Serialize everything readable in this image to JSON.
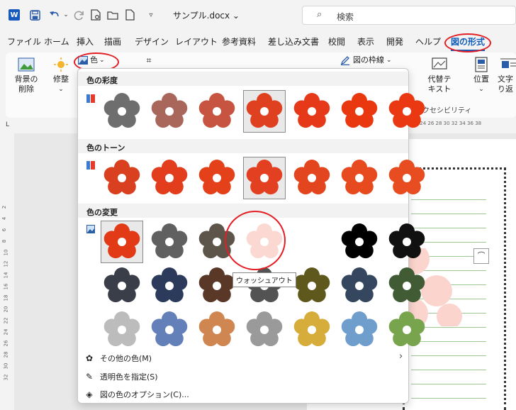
{
  "titlebar": {
    "logo": "W",
    "quick_icons": [
      "save-icon",
      "undo-icon",
      "redo-icon",
      "print-preview-icon",
      "open-icon",
      "new-icon",
      "customize-icon"
    ],
    "doc_name": "サンプル.docx ⌄",
    "search_placeholder": "検索",
    "search_icon": "⌕"
  },
  "menubar": {
    "tabs": [
      "ファイル",
      "ホーム",
      "挿入",
      "描画",
      "デザイン",
      "レイアウト",
      "参考資料",
      "差し込み文書",
      "校閲",
      "表示",
      "開発",
      "ヘルプ",
      "図の形式"
    ],
    "active": "図の形式"
  },
  "ribbon": {
    "remove_bg": "背景の\n削除",
    "corrections": "修整",
    "color_btn": "色",
    "border_btn": "図の枠線",
    "alt_text": "代替テ\nキスト",
    "position": "位置",
    "wrap_text": "文字\nり返",
    "accessibility": "アクセシビリティ"
  },
  "ruler": {
    "horizontal": "20 22 24 26 28 30 32 34 36 38",
    "vertical": [
      "2",
      "4",
      "6",
      "8",
      "10",
      "12",
      "14",
      "16",
      "18",
      "20",
      "22",
      "24",
      "26",
      "28",
      "30",
      "32"
    ],
    "marker": "L"
  },
  "dropdown": {
    "saturation": {
      "title": "色の彩度",
      "colors": [
        "#6e6e6e",
        "#a9665a",
        "#c65440",
        "#de4020",
        "#e5391a",
        "#e9370f",
        "#ea3812"
      ],
      "selected": 3
    },
    "tone": {
      "title": "色のトーン",
      "colors": [
        "#d94020",
        "#e23d1d",
        "#e4411b",
        "#e24020",
        "#e3451e",
        "#e64a1e",
        "#e84d22"
      ],
      "selected": 3
    },
    "recolor": {
      "title": "色の変更",
      "colors": [
        "#e23a16",
        "#606060",
        "#5d554a",
        "#fcd8d2",
        "#ffffff",
        "#000000",
        "#111111",
        "#3a3e49",
        "#2c3a5c",
        "#5a3828",
        "#535353",
        "#5e581c",
        "#35475f",
        "#415b34",
        "#bcbcbc",
        "#6380b8",
        "#cf8650",
        "#9a9a9a",
        "#d6ad3a",
        "#6f9ecc",
        "#77a44d"
      ],
      "selected": 0,
      "highlight": 3
    },
    "tooltip": "ウォッシュアウト",
    "more_colors": "その他の色(M)",
    "set_transparent": "透明色を指定(S)",
    "picture_options": "図の色のオプション(C)..."
  }
}
